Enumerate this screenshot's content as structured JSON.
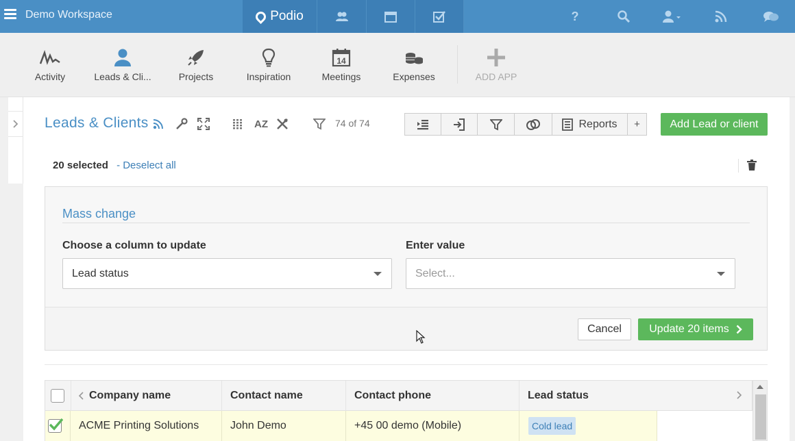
{
  "topbar": {
    "workspace_title": "Demo Workspace",
    "logo_text": "Podio",
    "icons": [
      "contacts-icon",
      "calendar-icon",
      "tasks-icon",
      "help-icon",
      "search-icon",
      "user-menu-icon",
      "feed-icon",
      "chat-icon"
    ],
    "icon_glyphs": {
      "help": "?"
    }
  },
  "apps": [
    {
      "label": "Activity",
      "icon": "activity-icon"
    },
    {
      "label": "Leads & Cli...",
      "icon": "leads-icon"
    },
    {
      "label": "Projects",
      "icon": "rocket-icon"
    },
    {
      "label": "Inspiration",
      "icon": "lightbulb-icon"
    },
    {
      "label": "Meetings",
      "icon": "calendar-icon",
      "date": "14"
    },
    {
      "label": "Expenses",
      "icon": "coins-icon"
    },
    {
      "label": "ADD APP",
      "icon": "plus-icon"
    }
  ],
  "header": {
    "title": "Leads & Clients",
    "filter_count": "74 of 74",
    "reports_label": "Reports",
    "plus_label": "+",
    "az_label": "AZ",
    "add_label": "Add Lead or client"
  },
  "selection": {
    "count_label": "20 selected",
    "deselect_label": "- Deselect all"
  },
  "mass_change": {
    "title": "Mass change",
    "column_label": "Choose a column to update",
    "column_value": "Lead status",
    "value_label": "Enter value",
    "value_placeholder": "Select...",
    "cancel_label": "Cancel",
    "update_label": "Update 20 items"
  },
  "table": {
    "columns": [
      "Company name",
      "Contact name",
      "Contact phone",
      "Lead status"
    ],
    "rows": [
      {
        "checked": true,
        "company": "ACME Printing Solutions",
        "contact": "John Demo",
        "phone": "+45 00 demo (Mobile)",
        "status": "Cold lead"
      }
    ]
  },
  "colors": {
    "topbar": "#4a8fc5",
    "accent": "#4a8fc5",
    "green_button": "#5cb85c",
    "selected_row": "#fdfde0",
    "badge_bg": "#cfe2f3"
  }
}
